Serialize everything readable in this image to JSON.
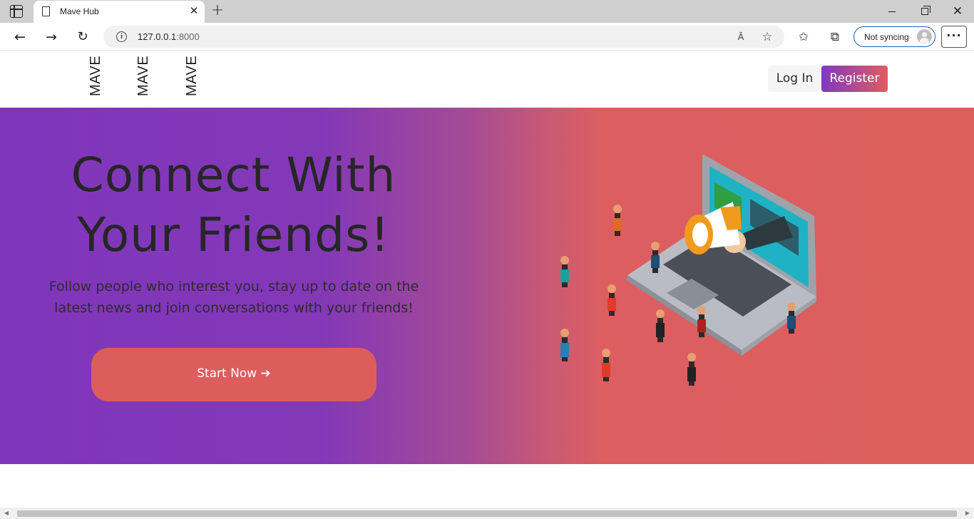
{
  "browser": {
    "tab_title": "Mave Hub",
    "url_host": "127.0.0.1",
    "url_port": ":8000",
    "read_aloud_glyph": "Ă",
    "profile_label": "Not syncing"
  },
  "site": {
    "logo_items": [
      "MAVE",
      "MAVE",
      "MAVE"
    ],
    "login_label": "Log In",
    "register_label": "Register"
  },
  "hero": {
    "title_line1": "Connect With",
    "title_line2": "Your Friends!",
    "subtitle": "Follow people who interest you, stay up to date on the latest news and join conversations with your friends!",
    "cta_label": "Start Now ➔",
    "illustration_icon": "laptop-megaphone-people-illustration"
  },
  "colors": {
    "gradient_start": "#8036bc",
    "gradient_end": "#dc5f5e",
    "cta_bg": "#dd5d5d",
    "text_dark": "#262626"
  }
}
